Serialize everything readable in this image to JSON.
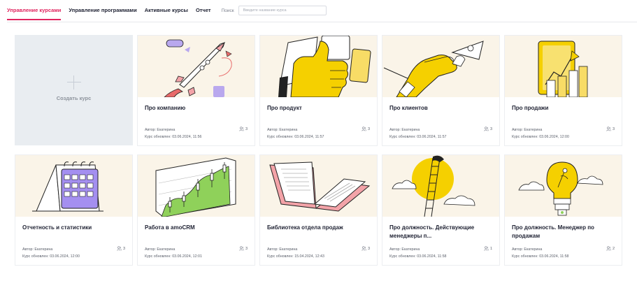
{
  "nav": {
    "tabs": [
      {
        "label": "Управление курсами",
        "active": true
      },
      {
        "label": "Управление программами",
        "active": false
      },
      {
        "label": "Активные курсы",
        "active": false
      },
      {
        "label": "Отчет",
        "active": false
      }
    ],
    "search_label": "Поиск",
    "search_placeholder": "Введите название курса",
    "search_value": ""
  },
  "create": {
    "label": "Создать курс",
    "icon": "plus-icon"
  },
  "accent_color": "#e0245e",
  "illustration_accent": "#f5d000",
  "courses": [
    {
      "title": "Про компанию",
      "author": "Автор: Екатерина",
      "updated": "Курс обновлен: 03.06.2024, 11:56",
      "count": "3",
      "illustration": "rocket-illustration"
    },
    {
      "title": "Про продукт",
      "author": "Автор: Екатерина",
      "updated": "Курс обновлен: 03.06.2024, 11:57",
      "count": "3",
      "illustration": "thumbs-up-illustration"
    },
    {
      "title": "Про клиентов",
      "author": "Автор: Екатерина",
      "updated": "Курс обновлен: 03.06.2024, 11:57",
      "count": "3",
      "illustration": "handshake-illustration"
    },
    {
      "title": "Про продажи",
      "author": "Автор: Екатерина",
      "updated": "Курс обновлен: 03.06.2024, 12:00",
      "count": "3",
      "illustration": "growth-chart-illustration"
    },
    {
      "title": "Отчетность и статистики",
      "author": "Автор: Екатерина",
      "updated": "Курс обновлен: 03.06.2024, 12:00",
      "count": "3",
      "illustration": "calendar-illustration"
    },
    {
      "title": "Работа в amoCRM",
      "author": "Автор: Екатерина",
      "updated": "Курс обновлен: 03.06.2024, 12:01",
      "count": "3",
      "illustration": "candlestick-illustration"
    },
    {
      "title": "Библиотека отдела продаж",
      "author": "Автор: Екатерина",
      "updated": "Курс обновлен: 15.04.2024, 12:43",
      "count": "3",
      "illustration": "open-book-illustration"
    },
    {
      "title": "Про должность. Действующие менеджеры п...",
      "author": "Автор: Екатерина",
      "updated": "Курс обновлен: 03.06.2024, 11:58",
      "count": "1",
      "illustration": "ladder-illustration"
    },
    {
      "title": "Про должность. Менеджер по продажам",
      "author": "Автор: Екатерина",
      "updated": "Курс обновлен: 03.06.2024, 11:58",
      "count": "2",
      "illustration": "lightbulb-illustration"
    }
  ]
}
